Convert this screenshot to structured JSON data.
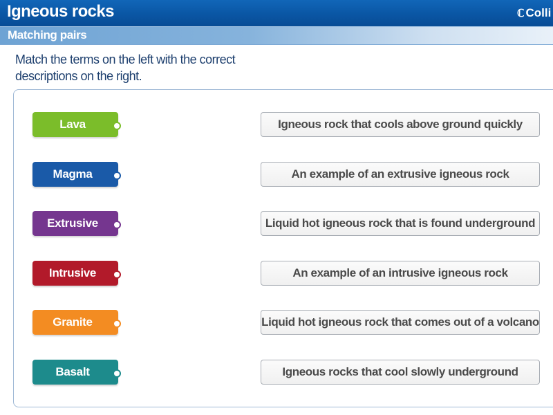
{
  "header": {
    "title": "Igneous rocks",
    "brand": "Colli",
    "brand_icon": "collins-logo-icon"
  },
  "subheader": {
    "title": "Matching pairs"
  },
  "instructions": "Match the terms on the left with the correct descriptions on the right.",
  "terms": [
    {
      "label": "Lava",
      "color": "#7bbd2a"
    },
    {
      "label": "Magma",
      "color": "#1a5aa8"
    },
    {
      "label": "Extrusive",
      "color": "#75368f"
    },
    {
      "label": "Intrusive",
      "color": "#b21a2a"
    },
    {
      "label": "Granite",
      "color": "#f38c22"
    },
    {
      "label": "Basalt",
      "color": "#1d8b8c"
    }
  ],
  "descriptions": [
    {
      "label": "Igneous rock that cools above ground quickly"
    },
    {
      "label": "An example of an extrusive igneous rock"
    },
    {
      "label": "Liquid hot igneous rock that is found underground"
    },
    {
      "label": "An example of an intrusive igneous rock"
    },
    {
      "label": "Liquid hot igneous rock that comes out of a volcano"
    },
    {
      "label": "Igneous rocks that cool slowly underground"
    }
  ]
}
